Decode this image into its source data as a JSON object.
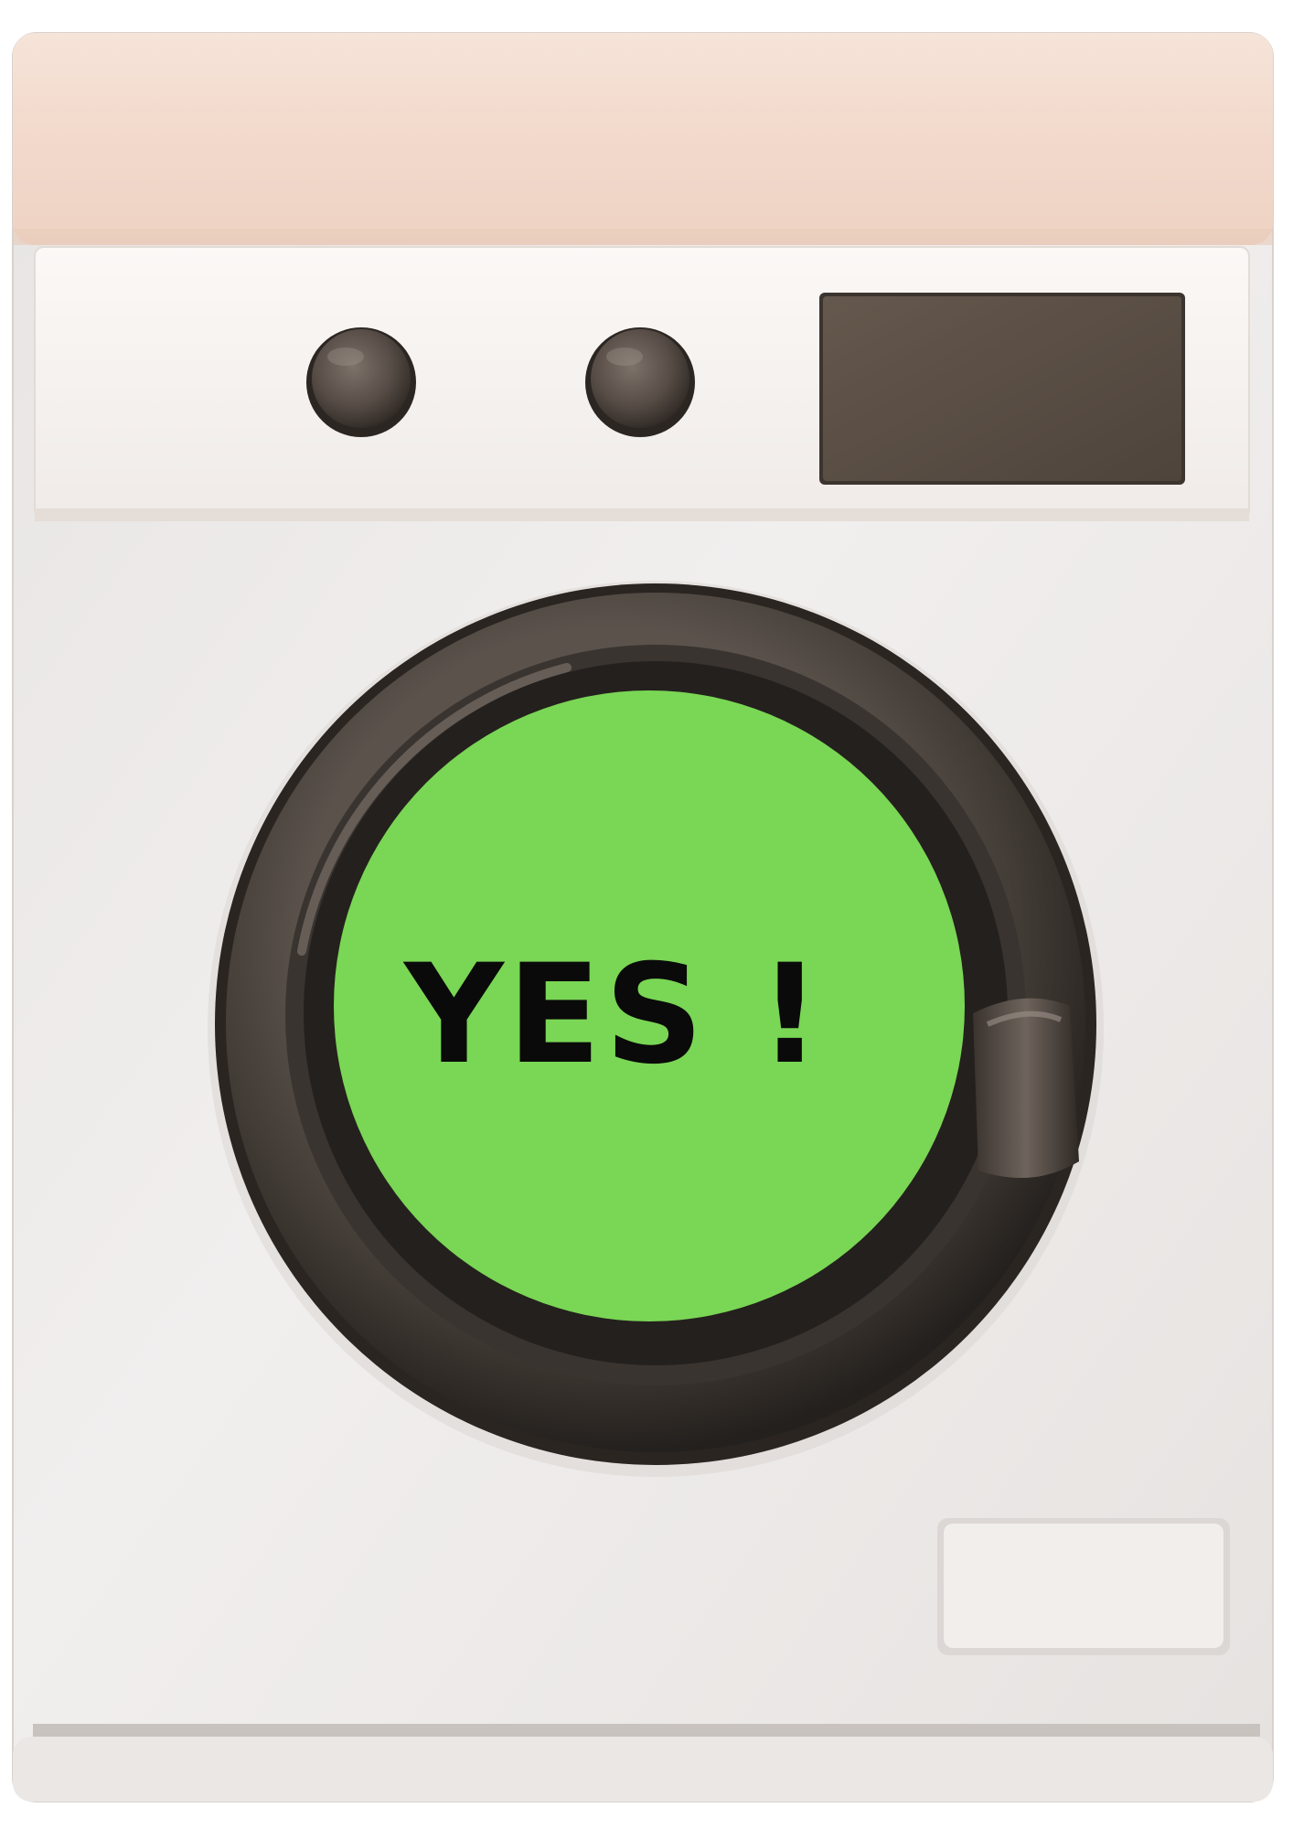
{
  "door_window": {
    "text": "YES !",
    "background_color": "#7ad655",
    "text_color": "#0a0a0a"
  },
  "machine": {
    "body_color": "#ebe9e8",
    "top_color": "#f3ddd1",
    "knob_color": "#5a5049",
    "display_color": "#5c5045",
    "door_ring_color": "#3e3833"
  },
  "icons": [
    "washing-machine-icon",
    "knob-icon",
    "display-panel-icon",
    "door-handle-icon",
    "detergent-drawer-icon"
  ]
}
